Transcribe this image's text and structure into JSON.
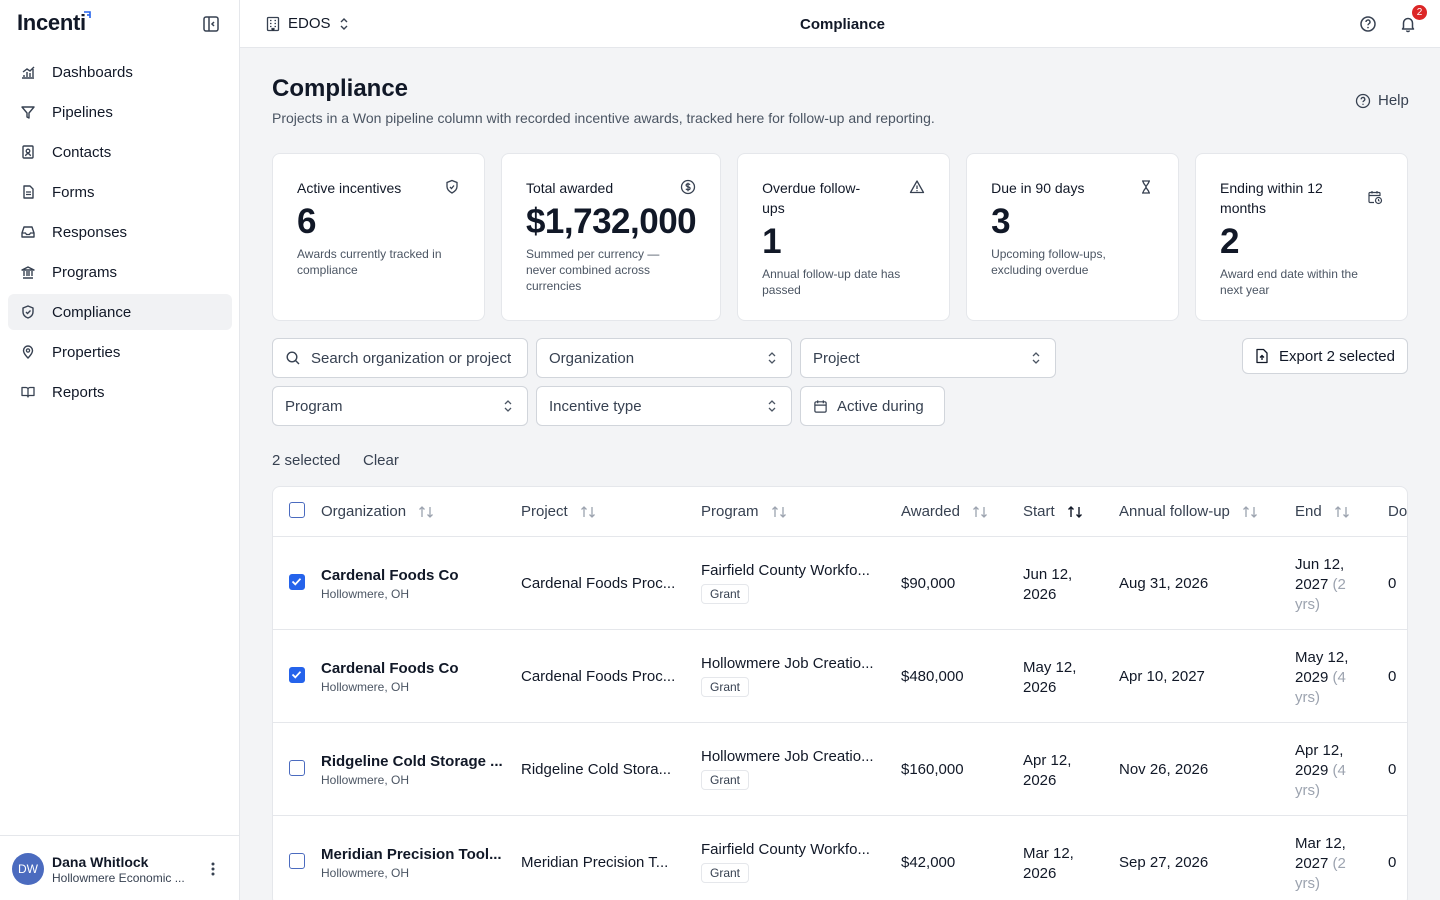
{
  "app": {
    "name": "Incenti"
  },
  "sidebar": {
    "items": [
      {
        "label": "Dashboards",
        "icon": "chart-bar-icon"
      },
      {
        "label": "Pipelines",
        "icon": "funnel-icon"
      },
      {
        "label": "Contacts",
        "icon": "contact-book-icon"
      },
      {
        "label": "Forms",
        "icon": "document-icon"
      },
      {
        "label": "Responses",
        "icon": "inbox-icon"
      },
      {
        "label": "Programs",
        "icon": "landmark-icon"
      },
      {
        "label": "Compliance",
        "icon": "shield-check-icon",
        "active": true
      },
      {
        "label": "Properties",
        "icon": "map-pin-icon"
      },
      {
        "label": "Reports",
        "icon": "book-open-icon"
      }
    ],
    "user": {
      "initials": "DW",
      "name": "Dana Whitlock",
      "org": "Hollowmere Economic ..."
    }
  },
  "topbar": {
    "org": "EDOS",
    "title": "Compliance",
    "notifications": "2"
  },
  "page": {
    "title": "Compliance",
    "subtitle": "Projects in a Won pipeline column with recorded incentive awards, tracked here for follow-up and reporting.",
    "help": "Help"
  },
  "cards": [
    {
      "label": "Active incentives",
      "value": "6",
      "desc": "Awards currently tracked in compliance",
      "icon": "shield-icon"
    },
    {
      "label": "Total awarded",
      "value": "$1,732,000",
      "desc": "Summed per currency — never combined across currencies",
      "icon": "dollar-circle-icon"
    },
    {
      "label": "Overdue follow-ups",
      "value": "1",
      "desc": "Annual follow-up date has passed",
      "icon": "warning-icon"
    },
    {
      "label": "Due in 90 days",
      "value": "3",
      "desc": "Upcoming follow-ups, excluding overdue",
      "icon": "hourglass-icon"
    },
    {
      "label": "Ending within 12 months",
      "value": "2",
      "desc": "Award end date within the next year",
      "icon": "calendar-clock-icon"
    }
  ],
  "filters": {
    "search_placeholder": "Search organization or project",
    "organization": "Organization",
    "project": "Project",
    "program": "Program",
    "incentive_type": "Incentive type",
    "active_during": "Active during",
    "export": "Export 2 selected"
  },
  "selection": {
    "count": "2 selected",
    "clear": "Clear"
  },
  "table": {
    "columns": [
      "Organization",
      "Project",
      "Program",
      "Awarded",
      "Start",
      "Annual follow-up",
      "End",
      "Doc"
    ],
    "rows": [
      {
        "checked": true,
        "org": "Cardenal Foods Co",
        "loc": "Hollowmere, OH",
        "project": "Cardenal Foods Proc...",
        "program": "Fairfield County Workfo...",
        "type": "Grant",
        "awarded": "$90,000",
        "start1": "Jun 12,",
        "start2": "2026",
        "follow": "Aug 31, 2026",
        "end1": "Jun 12,",
        "end2": "2027",
        "end_dur1": "(2",
        "end_dur2": "yrs)",
        "docs": "0"
      },
      {
        "checked": true,
        "org": "Cardenal Foods Co",
        "loc": "Hollowmere, OH",
        "project": "Cardenal Foods Proc...",
        "program": "Hollowmere Job Creatio...",
        "type": "Grant",
        "awarded": "$480,000",
        "start1": "May 12,",
        "start2": "2026",
        "follow": "Apr 10, 2027",
        "end1": "May 12,",
        "end2": "2029",
        "end_dur1": "(4",
        "end_dur2": "yrs)",
        "docs": "0"
      },
      {
        "checked": false,
        "org": "Ridgeline Cold Storage ...",
        "loc": "Hollowmere, OH",
        "project": "Ridgeline Cold Stora...",
        "program": "Hollowmere Job Creatio...",
        "type": "Grant",
        "awarded": "$160,000",
        "start1": "Apr 12,",
        "start2": "2026",
        "follow": "Nov 26, 2026",
        "end1": "Apr 12,",
        "end2": "2029",
        "end_dur1": "(4",
        "end_dur2": "yrs)",
        "docs": "0"
      },
      {
        "checked": false,
        "org": "Meridian Precision Tool...",
        "loc": "Hollowmere, OH",
        "project": "Meridian Precision T...",
        "program": "Fairfield County Workfo...",
        "type": "Grant",
        "awarded": "$42,000",
        "start1": "Mar 12,",
        "start2": "2026",
        "follow": "Sep 27, 2026",
        "end1": "Mar 12,",
        "end2": "2027",
        "end_dur1": "(2",
        "end_dur2": "yrs)",
        "docs": "0"
      }
    ]
  }
}
